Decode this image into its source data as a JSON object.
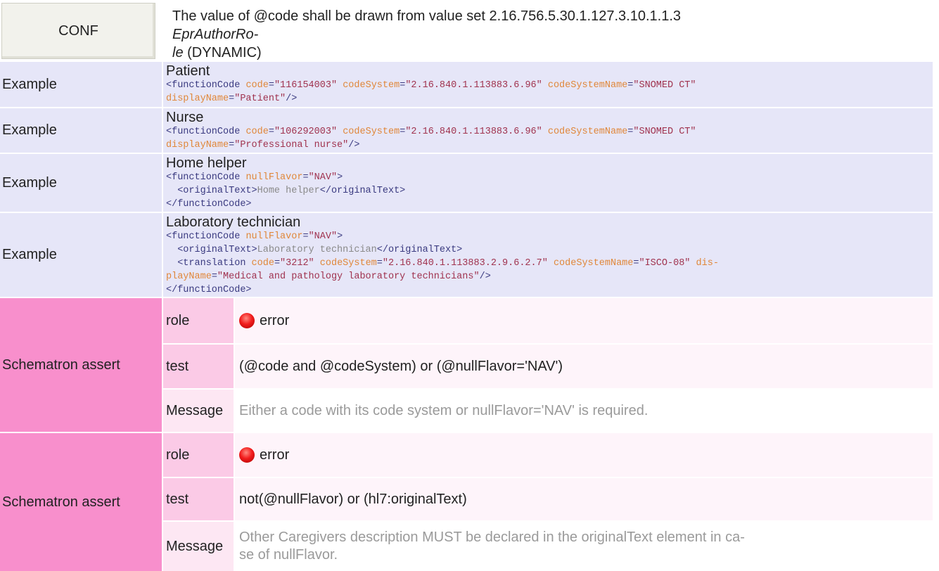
{
  "conf": {
    "label": "CONF",
    "text_prefix": "The value of @code shall be drawn from value set 2.16.756.5.30.1.127.3.10.1.1.3 ",
    "value_set_name_line1": "EprAuthorRo-",
    "value_set_name_line2": "le",
    "text_suffix": " (DYNAMIC)"
  },
  "examples": [
    {
      "label": "Example",
      "title": "Patient",
      "code": {
        "elem": "<functionCode",
        "a1": "code",
        "v1": "\"116154003\"",
        "a2": "codeSystem",
        "v2": "\"2.16.840.1.113883.6.96\"",
        "a3": "codeSystemName",
        "v3": "\"SNOMED CT\"",
        "a4": "displayName",
        "v4": "\"Patient\"",
        "close": "/>"
      }
    },
    {
      "label": "Example",
      "title": "Nurse",
      "code": {
        "elem": "<functionCode",
        "a1": "code",
        "v1": "\"106292003\"",
        "a2": "codeSystem",
        "v2": "\"2.16.840.1.113883.6.96\"",
        "a3": "codeSystemName",
        "v3": "\"SNOMED CT\"",
        "a4": "displayName",
        "v4": "\"Professional nurse\"",
        "close": "/>"
      }
    },
    {
      "label": "Example",
      "title": "Home helper",
      "code": {
        "open": "<functionCode",
        "attr": "nullFlavor",
        "val": "\"NAV\"",
        "open_end": ">",
        "ot_open": "<originalText>",
        "ot_text": "Home helper",
        "ot_close": "</originalText>",
        "close": "</functionCode>"
      }
    },
    {
      "label": "Example",
      "title": "Laboratory technician",
      "code": {
        "open": "<functionCode",
        "attr": "nullFlavor",
        "val": "\"NAV\"",
        "open_end": ">",
        "ot_open": "<originalText>",
        "ot_text": "Laboratory technician",
        "ot_close": "</originalText>",
        "tr_elem": "<translation",
        "a1": "code",
        "v1": "\"3212\"",
        "a2": "codeSystem",
        "v2": "\"2.16.840.1.113883.2.9.6.2.7\"",
        "a3": "codeSystemName",
        "v3": "\"ISCO-08\"",
        "a4_line1": "dis-",
        "a4_line2": "playName",
        "v4": "\"Medical and pathology laboratory technicians\"",
        "tr_close": "/>",
        "close": "</functionCode>"
      }
    }
  ],
  "schematron": [
    {
      "label": "Schematron assert",
      "role_key": "role",
      "role_value": "error",
      "test_key": "test",
      "test_value": "(@code and @codeSystem) or (@nullFlavor='NAV')",
      "message_key": "Message",
      "message_value": "Either a code with its code system or nullFlavor='NAV' is required."
    },
    {
      "label": "Schematron assert",
      "role_key": "role",
      "role_value": "error",
      "test_key": "test",
      "test_value": "not(@nullFlavor) or (hl7:originalText)",
      "message_key": "Message",
      "message_line1": "Other Caregivers description MUST be declared in the originalText element in ca-",
      "message_line2": "se of nullFlavor."
    }
  ],
  "colors": {
    "example_bg": "#e6e6f8",
    "schematron_label_bg": "#f88fcc",
    "xml_element": "#3a3a80",
    "xml_attribute": "#e0873a",
    "xml_value": "#a0334f",
    "error_icon": "#f21d1d"
  },
  "icons": {
    "role_error": "error-dot-icon"
  }
}
